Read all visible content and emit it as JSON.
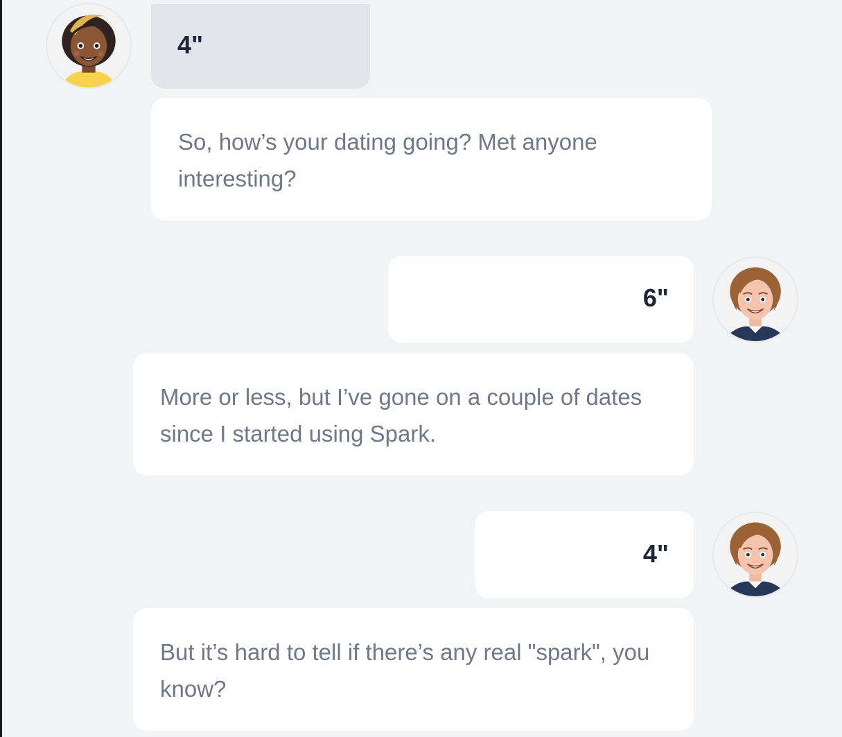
{
  "conversation": {
    "messages": [
      {
        "speaker": "female",
        "type": "audio",
        "duration": "4\""
      },
      {
        "speaker": "female",
        "type": "text",
        "text": "So, how’s your dating going? Met anyone interesting?"
      },
      {
        "speaker": "male",
        "type": "audio",
        "duration": "6\""
      },
      {
        "speaker": "male",
        "type": "text",
        "text": "More or less, but I’ve gone on a couple of dates since I started using Spark."
      },
      {
        "speaker": "male",
        "type": "audio",
        "duration": "4\""
      },
      {
        "speaker": "male",
        "type": "text",
        "text": "But it’s hard to tell if there’s any real \"spark\", you know?"
      }
    ]
  },
  "colors": {
    "background": "#f2f3f5",
    "bubble_white": "#ffffff",
    "bubble_grey": "#e1e5eb",
    "duration_text": "#1d2638",
    "message_text": "#6f7889"
  },
  "icons": {
    "female_avatar": "female-avatar-icon",
    "male_avatar": "male-avatar-icon"
  }
}
